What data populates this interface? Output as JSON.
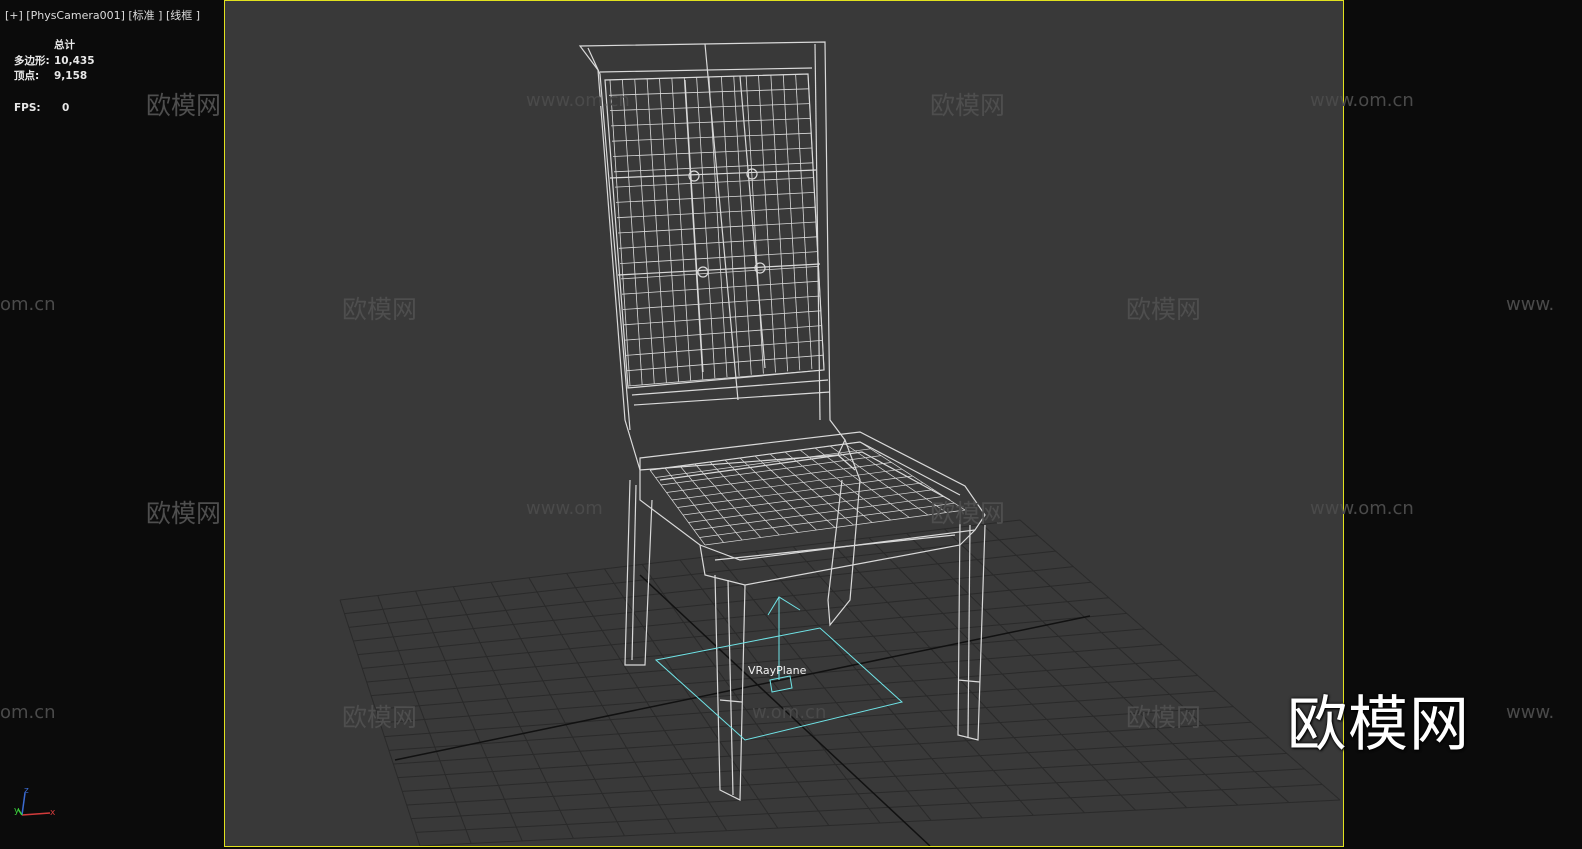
{
  "viewport": {
    "label": "[+]  [PhysCamera001]  [标准 ]  [线框 ]",
    "border_color": "#e1e11e",
    "background": "#393939"
  },
  "stats": {
    "title": "总计",
    "polygons_label": "多边形:",
    "polygons_value": "10,435",
    "vertices_label": "顶点:",
    "vertices_value": "9,158",
    "fps_label": "FPS:",
    "fps_value": "0"
  },
  "scene": {
    "object_label": "VRayPlane",
    "object_color": "#6fe3e6",
    "wire_color": "#d9d9d9"
  },
  "watermarks": {
    "cn": "欧模网",
    "url": "www.om.cn",
    "url_partial_left": "om.cn",
    "url_partial_right": "www.",
    "url_partial_mid": "www.om",
    "url_partial_low": "w.om.cn"
  },
  "logo": "欧模网",
  "axis": {
    "x": "x",
    "y": "y",
    "z": "z"
  }
}
